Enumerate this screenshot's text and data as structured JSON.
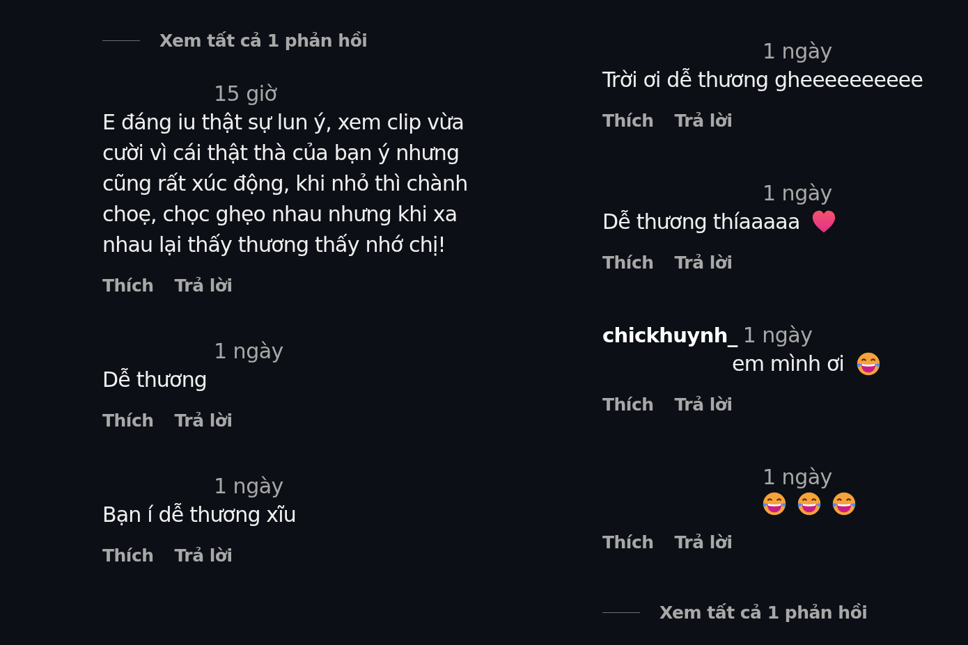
{
  "columns": [
    {
      "items": [
        {
          "kind": "more-replies",
          "label": "Xem tất cả 1 phản hồi"
        },
        {
          "kind": "comment",
          "time": "15 giờ",
          "text": "E đáng iu thật sự lun ý, xem clip vừa cười vì cái thật thà của bạn ý nhưng cũng rất xúc động, khi nhỏ thì chành choẹ, chọc ghẹo nhau nhưng khi xa nhau lại thấy thương thấy nhớ chị!",
          "actions": [
            "Thích",
            "Trả lời"
          ]
        },
        {
          "kind": "comment",
          "time": "1 ngày",
          "text": "Dễ thương",
          "actions": [
            "Thích",
            "Trả lời"
          ]
        },
        {
          "kind": "comment",
          "time": "1 ngày",
          "text": "Bạn í dễ thương xĩu",
          "actions": [
            "Thích",
            "Trả lời"
          ]
        }
      ]
    },
    {
      "items": [
        {
          "kind": "comment",
          "time": "1 ngày",
          "text": "Trời ơi dễ thương gheeeeeeeeee",
          "actions": [
            "Thích",
            "Trả lời"
          ]
        },
        {
          "kind": "comment",
          "time": "1 ngày",
          "text": "Dễ thương thíaaaaa",
          "icons": [
            {
              "kind": "heart"
            }
          ],
          "actions": [
            "Thích",
            "Trả lời"
          ]
        },
        {
          "kind": "comment",
          "username": "chickhuynh_",
          "time": "1 ngày",
          "text": "em mình ơi",
          "icons": [
            {
              "kind": "laugh"
            }
          ],
          "actions": [
            "Thích",
            "Trả lời"
          ]
        },
        {
          "kind": "comment",
          "time": "1 ngày",
          "icons": [
            {
              "kind": "laugh"
            },
            {
              "kind": "laugh"
            },
            {
              "kind": "laugh"
            }
          ],
          "actions": [
            "Thích",
            "Trả lời"
          ]
        },
        {
          "kind": "more-replies",
          "label": "Xem tất cả 1 phản hồi"
        }
      ]
    }
  ]
}
